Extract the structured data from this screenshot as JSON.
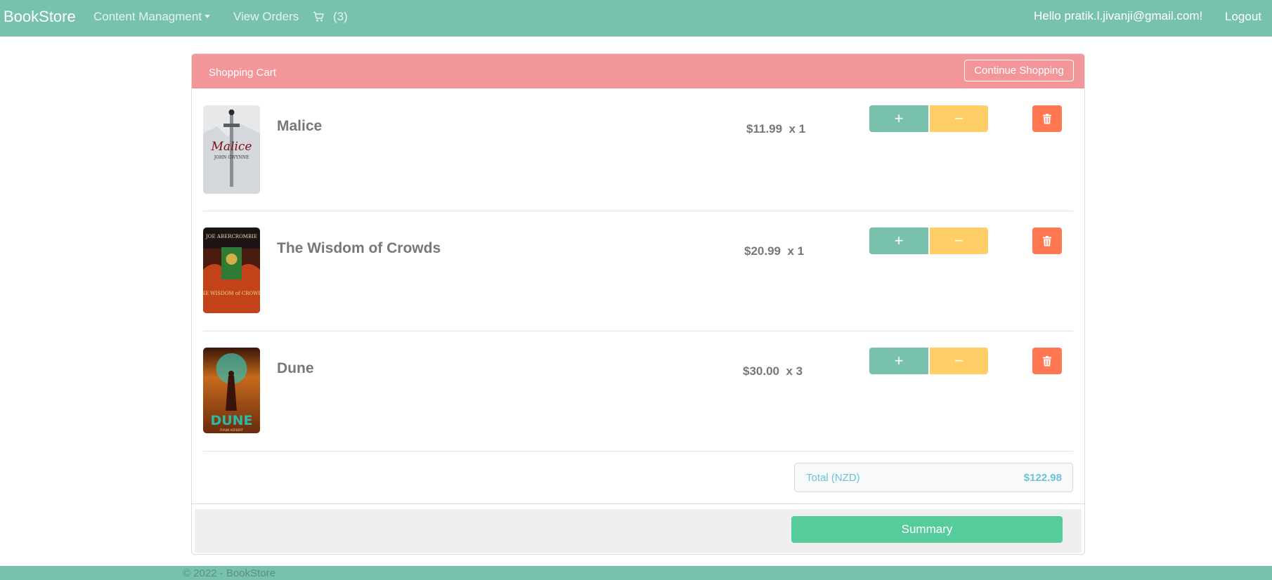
{
  "navbar": {
    "brand": "BookStore",
    "content_menu": "Content Managment",
    "orders": "View Orders",
    "cart_count": "(3)",
    "hello": "Hello pratik.l.jivanji@gmail.com!",
    "logout": "Logout"
  },
  "cart": {
    "header": "Shopping Cart",
    "continue_label": "Continue Shopping",
    "items": [
      {
        "title": "Malice",
        "price": "$11.99",
        "qty": "x 1",
        "cover_author": "JOHN GWYNNE",
        "cover_title": "Malice"
      },
      {
        "title": "The Wisdom of Crowds",
        "price": "$20.99",
        "qty": "x 1",
        "cover_author": "JOE ABERCROMBIE",
        "cover_title": "THE WISDOM of CROWDS"
      },
      {
        "title": "Dune",
        "price": "$30.00",
        "qty": "x 3",
        "cover_author": "FRANK HERBERT",
        "cover_title": "DUNE"
      }
    ],
    "plus_symbol": "+",
    "minus_symbol": "−",
    "total_label": "Total (NZD)",
    "total_value": "$122.98",
    "summary_label": "Summary"
  },
  "footer": {
    "text": "© 2022 - BookStore"
  },
  "colors": {
    "primary": "#78c2ad",
    "secondary_header": "#f3969a",
    "warning": "#ffce67",
    "danger": "#ff7851",
    "success": "#56cc9d",
    "info": "#6cc3d5"
  },
  "icons": [
    "cart-icon",
    "trash-icon",
    "caret-down-icon"
  ]
}
